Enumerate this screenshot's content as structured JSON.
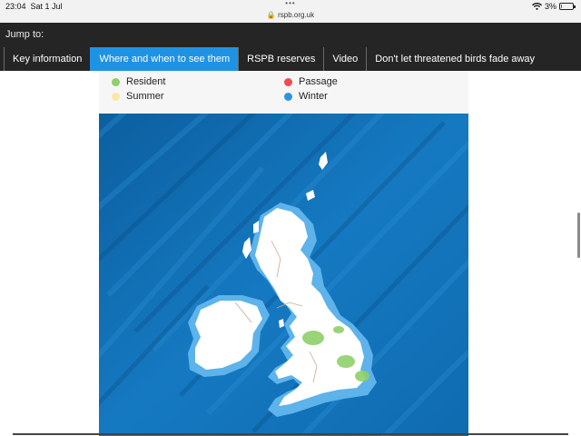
{
  "status_bar": {
    "time": "23:04",
    "date": "Sat 1 Jul",
    "url": "rspb.org.uk",
    "battery": "3%",
    "battery_level": 0.03
  },
  "nav": {
    "jump_label": "Jump to:",
    "tabs": [
      {
        "label": "Key information"
      },
      {
        "label": "Where and when to see them",
        "active": true
      },
      {
        "label": "RSPB reserves"
      },
      {
        "label": "Video"
      },
      {
        "label": "Don't let threatened birds fade away"
      }
    ]
  },
  "legend": {
    "items": [
      {
        "label": "Resident",
        "color": "#8fd06a"
      },
      {
        "label": "Passage",
        "color": "#ee4d4d"
      },
      {
        "label": "Summer",
        "color": "#fbe7a6"
      },
      {
        "label": "Winter",
        "color": "#2c95e2"
      }
    ]
  },
  "colors": {
    "accent": "#1f93e3",
    "nav_bg": "#252525",
    "sea": "#0f6fb4",
    "land": "#ffffff",
    "winter_coast": "#5db3ea",
    "resident": "#8fd06a"
  },
  "icons": [
    "wifi-icon",
    "battery-icon",
    "lock-icon",
    "more-dots-icon"
  ]
}
